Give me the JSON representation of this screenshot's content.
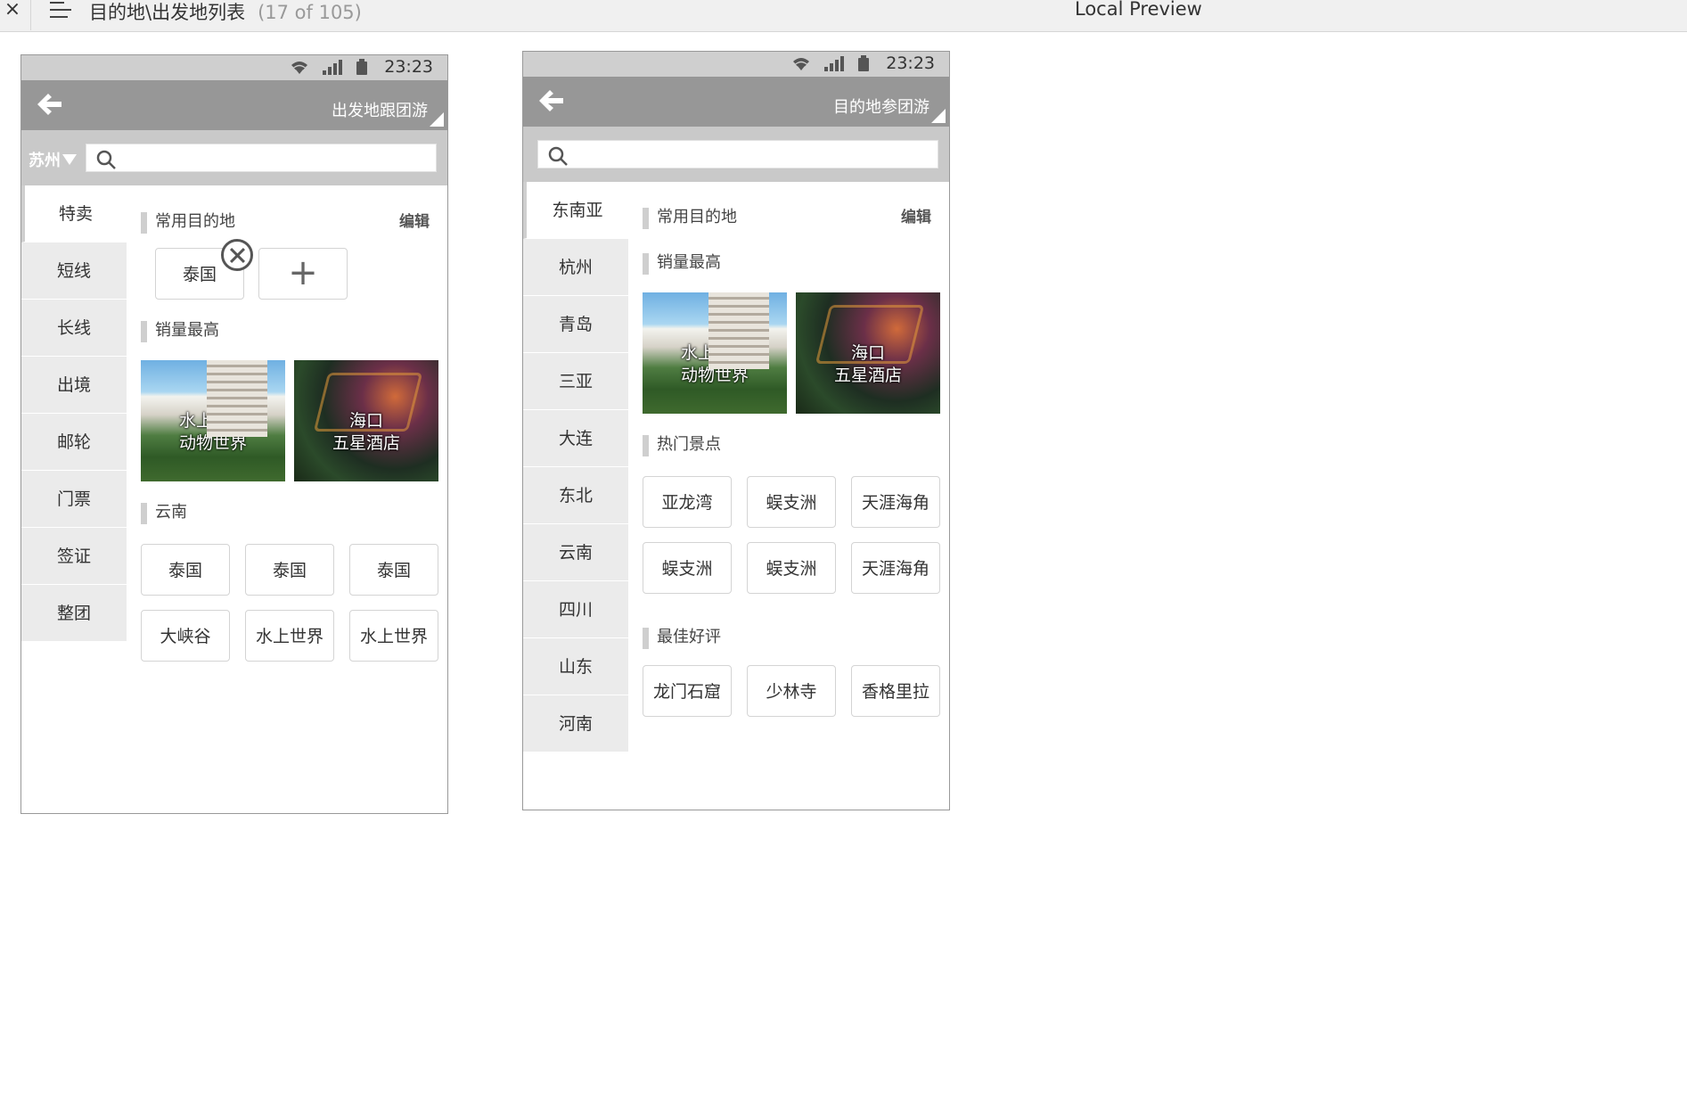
{
  "topbar": {
    "close_glyph": "×",
    "title": "目的地\\出发地列表",
    "count": "(17 of 105)",
    "preview_label": "Local Preview"
  },
  "phone1": {
    "time": "23:23",
    "nav_title": "出发地跟团游",
    "city": "苏州",
    "sidebar": [
      "特卖",
      "短线",
      "长线",
      "出境",
      "邮轮",
      "门票",
      "签证",
      "整团"
    ],
    "sec_common": "常用目的地",
    "edit": "编辑",
    "common_chips": [
      "泰国"
    ],
    "add_glyph": "+",
    "sec_top": "销量最高",
    "tiles": [
      {
        "line1": "水上乐园",
        "line2": "动物世界"
      },
      {
        "line1": "海口",
        "line2": "五星酒店"
      }
    ],
    "sec_region": "云南",
    "region_chips": [
      "泰国",
      "泰国",
      "泰国",
      "大峡谷",
      "水上世界",
      "水上世界"
    ]
  },
  "phone2": {
    "time": "23:23",
    "nav_title": "目的地参团游",
    "sidebar": [
      "东南亚",
      "杭州",
      "青岛",
      "三亚",
      "大连",
      "东北",
      "云南",
      "四川",
      "山东",
      "河南"
    ],
    "sec_common": "常用目的地",
    "edit": "编辑",
    "sec_top": "销量最高",
    "tiles": [
      {
        "line1": "水上乐园",
        "line2": "动物世界"
      },
      {
        "line1": "海口",
        "line2": "五星酒店"
      }
    ],
    "sec_hot": "热门景点",
    "hot_chips": [
      "亚龙湾",
      "蜈支洲",
      "天涯海角",
      "蜈支洲",
      "蜈支洲",
      "天涯海角"
    ],
    "sec_best": "最佳好评",
    "best_chips": [
      "龙门石窟",
      "少林寺",
      "香格里拉"
    ]
  },
  "icons": {
    "close": "close-icon",
    "menu": "menu-icon",
    "wifi": "wifi-icon",
    "signal": "signal-icon",
    "battery": "battery-icon",
    "back": "back-arrow-icon",
    "search": "search-icon",
    "remove": "remove-circle-icon",
    "dropdown": "caret-down-icon"
  },
  "colors": {
    "nav_bg": "#979797",
    "status_bg": "#cfcfcf",
    "search_bg": "#c9c9c9",
    "sidebar_bg": "#ebebeb"
  }
}
